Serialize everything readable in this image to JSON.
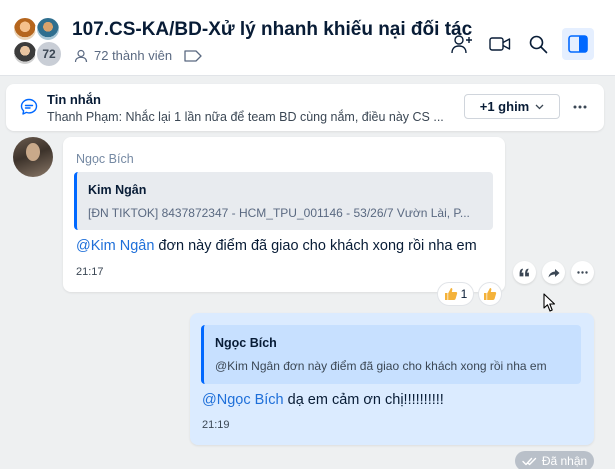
{
  "header": {
    "title": "107.CS-KA/BD-Xử lý nhanh khiếu nại đối tác",
    "member_count_badge": "72",
    "members_label": "72 thành viên",
    "actions": [
      "add-member-icon",
      "video-call-icon",
      "search-icon",
      "sidebar-toggle-icon"
    ]
  },
  "pinned": {
    "title": "Tin nhắn",
    "text": "Thanh Phạm: Nhắc lại 1 lần nữa để team BD cùng nắm, điều này CS ...",
    "pin_button": "+1 ghim"
  },
  "messages": [
    {
      "sender": "Ngọc Bích",
      "quote": {
        "name": "Kim Ngân",
        "text": "[ĐN TIKTOK] 8437872347 - HCM_TPU_001146 - 53/26/7 Vườn Lài, P..."
      },
      "mention": "@Kim Ngân",
      "text": " đơn này điểm đã giao cho khách xong rồi nha em",
      "time": "21:17",
      "reaction_count": "1"
    },
    {
      "quote": {
        "name": "Ngọc Bích",
        "text": "@Kim Ngân đơn này điểm đã giao cho khách xong rồi nha em"
      },
      "mention": "@Ngọc Bích",
      "text": " dạ em cảm ơn chị!!!!!!!!!!",
      "time": "21:19"
    }
  ],
  "status": {
    "seen_label": "Đã nhận"
  },
  "colors": {
    "accent": "#0068ff",
    "mention": "#1e6fd9",
    "own_bubble": "#dbebff",
    "background": "#eef0f1"
  }
}
